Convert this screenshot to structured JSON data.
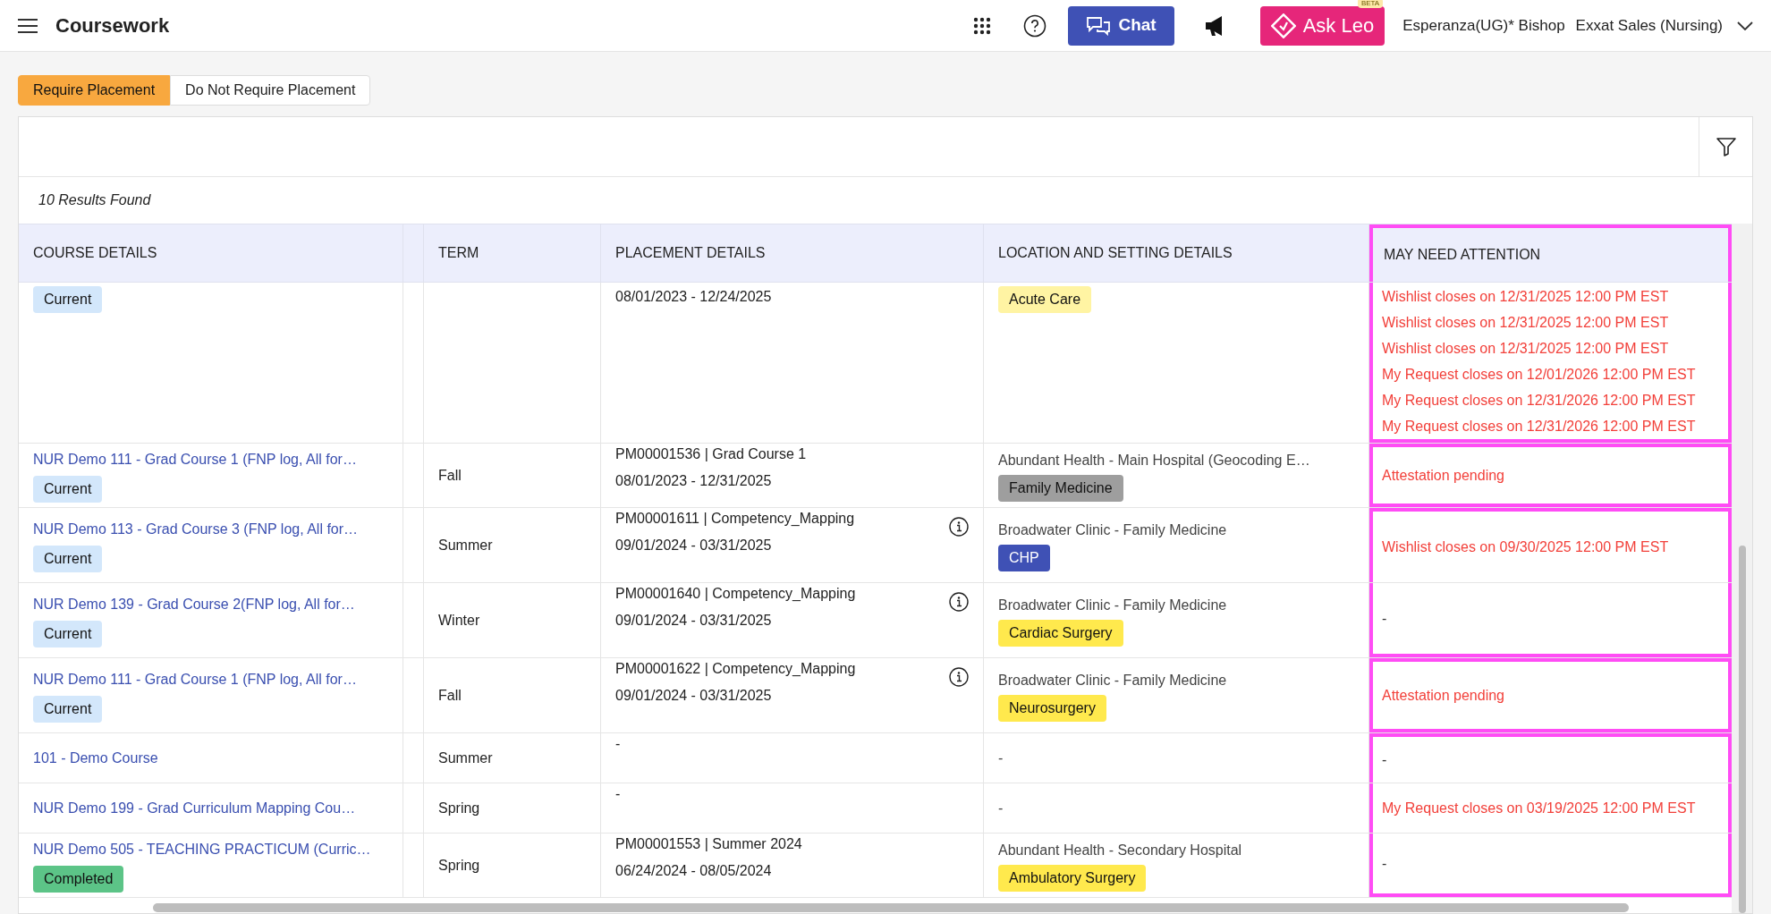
{
  "header": {
    "title": "Coursework",
    "chat_label": "Chat",
    "ask_label": "Ask Leo",
    "ask_badge": "BETA",
    "user": "Esperanza(UG)* Bishop",
    "org": "Exxat Sales (Nursing)"
  },
  "tabs": [
    {
      "label": "Require Placement",
      "selected": true
    },
    {
      "label": "Do Not Require Placement",
      "selected": false
    }
  ],
  "results": "10 Results Found",
  "table": {
    "columns": [
      "COURSE DETAILS",
      "TERM",
      "PLACEMENT DETAILS",
      "LOCATION AND SETTING DETAILS",
      "MAY NEED ATTENTION"
    ],
    "attention_header_framed": true,
    "rows": [
      {
        "status": {
          "label": "Current",
          "color": "#d3e7fb"
        },
        "placement": {
          "lines": [
            "08/01/2023 - 12/24/2025"
          ],
          "info": false
        },
        "location": {
          "tag": {
            "label": "Acute Care",
            "color": "#fff4a3"
          }
        },
        "attention": [
          {
            "kind": "alert",
            "text": "Wishlist closes on 12/31/2025 12:00 PM EST"
          },
          {
            "kind": "alert",
            "text": "Wishlist closes on 12/31/2025 12:00 PM EST"
          },
          {
            "kind": "alert",
            "text": "Wishlist closes on 12/31/2025 12:00 PM EST"
          },
          {
            "kind": "alert",
            "text": "My Request closes on 12/01/2026 12:00 PM EST"
          },
          {
            "kind": "alert",
            "text": "My Request closes on 12/31/2026 12:00 PM EST"
          },
          {
            "kind": "alert",
            "text": "My Request closes on 12/31/2026 12:00 PM EST"
          }
        ],
        "frame_top": false,
        "frame_bottom": true
      },
      {
        "course": "NUR Demo 111 - Grad Course 1 (FNP log, All for…",
        "status": {
          "label": "Current",
          "color": "#d3e7fb"
        },
        "term": "Fall",
        "placement": {
          "lines": [
            "PM00001536 | Grad Course 1",
            "08/01/2023 - 12/31/2025"
          ],
          "info": false
        },
        "location": {
          "site": "Abundant Health - Main Hospital (Geocoding E…",
          "tag": {
            "label": "Family Medicine",
            "color": "#9e9e9e"
          }
        },
        "attention": [
          {
            "kind": "alert",
            "text": "Attestation pending"
          }
        ],
        "frame_top": true,
        "frame_bottom": true
      },
      {
        "course": "NUR Demo 113 - Grad Course 3 (FNP log, All for…",
        "status": {
          "label": "Current",
          "color": "#d3e7fb"
        },
        "term": "Summer",
        "placement": {
          "lines": [
            "PM00001611 | Competency_Mapping",
            "09/01/2024 - 03/31/2025"
          ],
          "info": true
        },
        "location": {
          "site": "Broadwater Clinic - Family Medicine",
          "tag": {
            "label": "CHP",
            "color": "#3f51b5"
          }
        },
        "attention": [
          {
            "kind": "alert",
            "text": "Wishlist closes on 09/30/2025 12:00 PM EST"
          }
        ],
        "frame_top": true,
        "frame_bottom": false
      },
      {
        "course": "NUR Demo 139 - Grad Course 2(FNP log, All for…",
        "status": {
          "label": "Current",
          "color": "#d3e7fb"
        },
        "term": "Winter",
        "placement": {
          "lines": [
            "PM00001640 | Competency_Mapping",
            "09/01/2024 - 03/31/2025"
          ],
          "info": true
        },
        "location": {
          "site": "Broadwater Clinic - Family Medicine",
          "tag": {
            "label": "Cardiac Surgery",
            "color": "#ffe94d"
          }
        },
        "attention": [
          {
            "kind": "empty",
            "text": "-"
          }
        ],
        "frame_top": false,
        "frame_bottom": true
      },
      {
        "course": "NUR Demo 111 - Grad Course 1 (FNP log, All for…",
        "status": {
          "label": "Current",
          "color": "#d3e7fb"
        },
        "term": "Fall",
        "placement": {
          "lines": [
            "PM00001622 | Competency_Mapping",
            "09/01/2024 - 03/31/2025"
          ],
          "info": true
        },
        "location": {
          "site": "Broadwater Clinic - Family Medicine",
          "tag": {
            "label": "Neurosurgery",
            "color": "#ffe94d"
          }
        },
        "attention": [
          {
            "kind": "alert",
            "text": "Attestation pending"
          }
        ],
        "frame_top": true,
        "frame_bottom": true
      },
      {
        "course": "101 - Demo Course",
        "term": "Summer",
        "placement": {
          "lines": [
            "-"
          ],
          "info": false
        },
        "location": {
          "site": "-"
        },
        "attention": [
          {
            "kind": "empty",
            "text": "-"
          }
        ],
        "frame_top": true,
        "frame_bottom": false
      },
      {
        "course": "NUR Demo 199 - Grad Curriculum Mapping Cou…",
        "term": "Spring",
        "placement": {
          "lines": [
            "-"
          ],
          "info": false
        },
        "location": {
          "site": "-"
        },
        "attention": [
          {
            "kind": "alert",
            "text": "My Request closes on 03/19/2025 12:00 PM EST"
          }
        ],
        "frame_top": false,
        "frame_bottom": false
      },
      {
        "course": "NUR Demo 505 - TEACHING PRACTICUM (Curric…",
        "status": {
          "label": "Completed",
          "color": "#5cc487"
        },
        "term": "Spring",
        "placement": {
          "lines": [
            "PM00001553 | Summer 2024",
            "06/24/2024 - 08/05/2024"
          ],
          "info": false
        },
        "location": {
          "site": "Abundant Health - Secondary Hospital",
          "tag": {
            "label": "Ambulatory Surgery",
            "color": "#ffe94d"
          }
        },
        "attention": [
          {
            "kind": "empty",
            "text": "-"
          }
        ],
        "frame_top": false,
        "frame_bottom": true
      }
    ]
  }
}
